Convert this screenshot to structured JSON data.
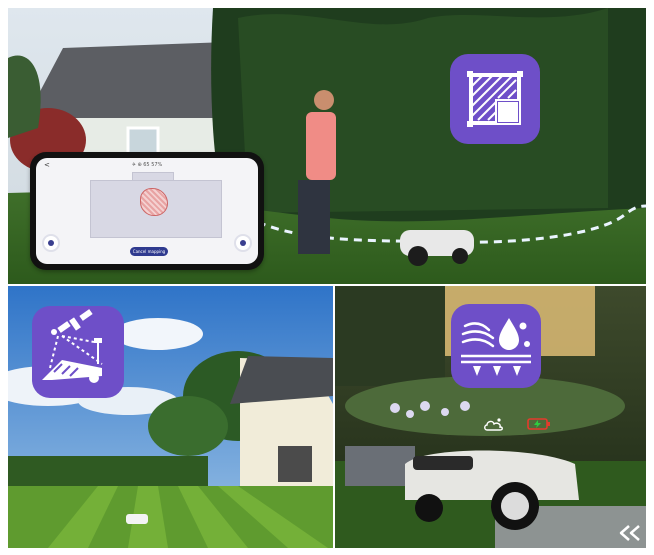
{
  "app_screen": {
    "status_text": "✈ ⊕ 65 57%",
    "back_label": "<",
    "button_label": "Cancel mapping"
  },
  "icons": {
    "top_feature": "mapping-zone-icon",
    "bottom_left_feature": "satellite-rtk-icon",
    "bottom_right_feature": "rain-sensor-icon",
    "weather": "cloud-sun-icon",
    "battery": "battery-charging-icon",
    "nav": "double-chevron-left-icon"
  },
  "colors": {
    "icon_bg": "#6e4fc8",
    "accent": "#3a3f8f",
    "battery_red": "#e53b2c",
    "battery_green": "#2ecc40"
  }
}
